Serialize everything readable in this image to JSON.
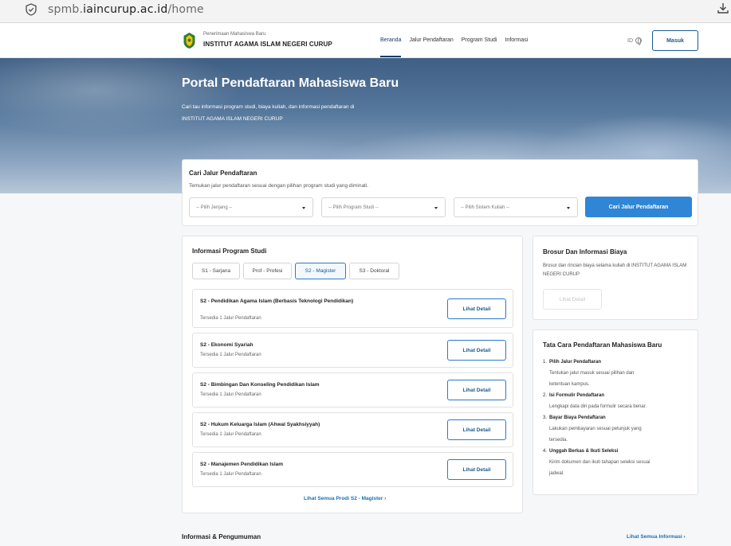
{
  "browser": {
    "url_host_prefix": "spmb.",
    "url_host_main": "iaincurup.ac.id",
    "url_path": "/home"
  },
  "header": {
    "brand_sub": "Penerimaan Mahasiswa Baru",
    "brand_title": "INSTITUT AGAMA ISLAM NEGERI CURUP",
    "nav": [
      "Beranda",
      "Jalur Pendaftaran",
      "Program Studi",
      "Informasi"
    ],
    "lang": "ID",
    "login_label": "Masuk"
  },
  "hero": {
    "title": "Portal Pendaftaran Mahasiswa Baru",
    "desc_line1": "Cari tau informasi program studi, biaya kuliah, dan informasi pendaftaran di",
    "desc_line2": "INSTITUT AGAMA ISLAM NEGERI CURUP"
  },
  "search": {
    "title": "Cari Jalur Pendaftaran",
    "subtitle": "Temukan jalur pendaftaran sesuai dengan pilihan program studi yang diminati.",
    "select_jenjang": "-- Pilih Jenjang --",
    "select_prodi": "-- Pilih Program Studi --",
    "select_sistem": "-- Pilih Sistem Kuliah --",
    "button": "Cari Jalur Pendaftaran"
  },
  "programs": {
    "title": "Informasi Program Studi",
    "tabs": [
      "S1 - Sarjana",
      "Prof - Profesi",
      "S2 - Magister",
      "S3 - Doktoral"
    ],
    "active_tab": "S2 - Magister",
    "items": [
      {
        "name": "S2 - Pendidikan Agama Islam (Berbasis Teknologi Pendidikan)",
        "available": "Tersedia 1 Jalur Pendaftaran"
      },
      {
        "name": "S2 - Ekonomi Syariah",
        "available": "Tersedia 1 Jalur Pendaftaran"
      },
      {
        "name": "S2 - Bimbingan Dan Konseling Pendidikan Islam",
        "available": "Tersedia 1 Jalur Pendaftaran"
      },
      {
        "name": "S2 - Hukum Keluarga Islam (Ahwal Syakhsiyyah)",
        "available": "Tersedia 1 Jalur Pendaftaran"
      },
      {
        "name": "S2 - Manajemen Pendidikan Islam",
        "available": "Tersedia 1 Jalur Pendaftaran"
      }
    ],
    "detail_label": "Lihat Detail",
    "see_all": "Lihat Semua Prodi S2 - Magister  ›"
  },
  "brochure": {
    "title": "Brosur Dan Informasi Biaya",
    "desc": "Brosur dan rincian biaya selama kuliah di INSTITUT AGAMA ISLAM NEGERI CURUP",
    "button": "Lihat Detail"
  },
  "procedure": {
    "title": "Tata Cara Pendaftaran Mahasiswa Baru",
    "steps": [
      {
        "title": "Pilih Jalur Pendaftaran",
        "desc1": "Tentukan jalur masuk sesuai pilihan dan",
        "desc2": "ketentuan kampus."
      },
      {
        "title": "Isi Formulir Pendaftaran",
        "desc1": "Lengkapi data diri pada formulir secara benar.",
        "desc2": ""
      },
      {
        "title": "Bayar Biaya Pendaftaran",
        "desc1": "Lakukan pembayaran sesuai petunjuk yang",
        "desc2": "tersedia."
      },
      {
        "title": "Unggah Berkas & Ikuti Seleksi",
        "desc1": "Kirim dokumen dan ikuti tahapan seleksi sesuai",
        "desc2": "jadwal."
      }
    ]
  },
  "announcements": {
    "title": "Informasi & Pengumuman",
    "see_all": "Lihat Semua Informasi  ›"
  },
  "colors": {
    "primary": "#2f86d6",
    "navy": "#1a3d6d"
  }
}
